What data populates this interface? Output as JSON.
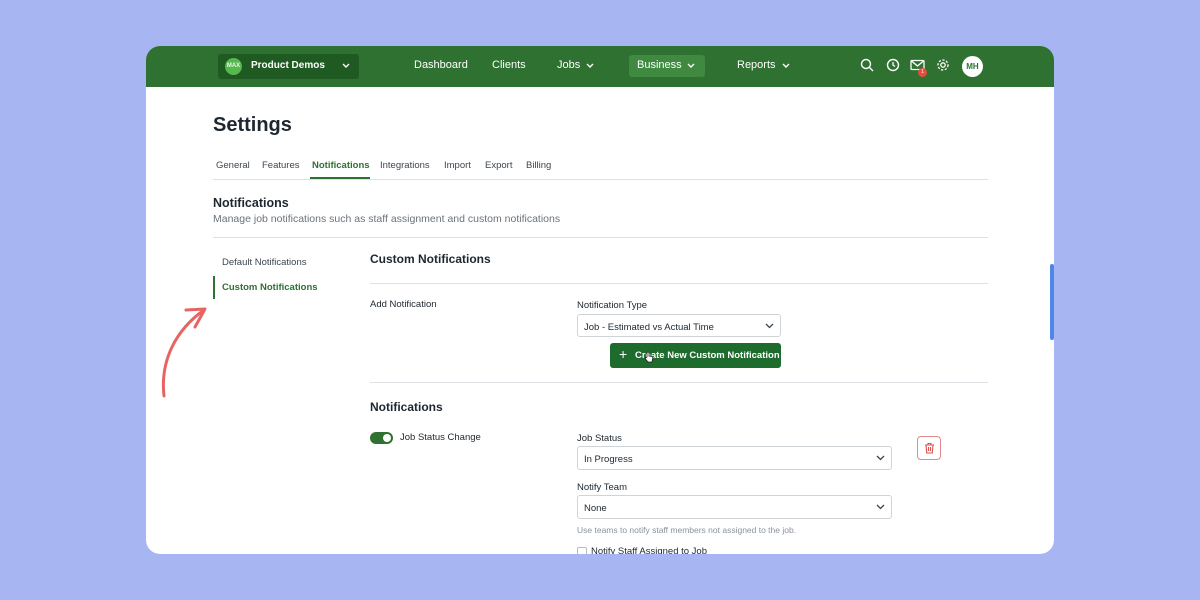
{
  "header": {
    "org_logo_text": "MAX",
    "org_name": "Product Demos",
    "nav": [
      {
        "label": "Dashboard"
      },
      {
        "label": "Clients"
      },
      {
        "label": "Jobs"
      },
      {
        "label": "Business"
      },
      {
        "label": "Reports"
      }
    ],
    "mail_badge": "1",
    "avatar_initials": "MH",
    "icons": [
      "search-icon",
      "clock-icon",
      "mail-icon",
      "gear-icon"
    ]
  },
  "page": {
    "title": "Settings",
    "tabs": [
      "General",
      "Features",
      "Notifications",
      "Integrations",
      "Import",
      "Export",
      "Billing"
    ],
    "active_tab": "Notifications"
  },
  "notifications_section": {
    "title": "Notifications",
    "description": "Manage job notifications such as staff assignment and custom notifications"
  },
  "sidebar": {
    "items": [
      {
        "label": "Default Notifications"
      },
      {
        "label": "Custom Notifications"
      }
    ],
    "active": "Custom Notifications"
  },
  "custom_notifications": {
    "title": "Custom Notifications",
    "add_label": "Add Notification",
    "type_label": "Notification Type",
    "type_value": "Job - Estimated vs Actual Time",
    "create_button": "Create New Custom Notification"
  },
  "notifications_list": {
    "title": "Notifications",
    "toggle_label": "Job Status Change",
    "toggle_on": true,
    "job_status_label": "Job Status",
    "job_status_value": "In Progress",
    "notify_team_label": "Notify Team",
    "notify_team_value": "None",
    "helper_text": "Use teams to notify staff members not assigned to the job.",
    "notify_staff_label": "Notify Staff Assigned to Job"
  },
  "colors": {
    "background": "#a8b5f3",
    "brand_green": "#2e7131",
    "button_green": "#1e6b2e",
    "danger": "#e08a8a",
    "annotation_arrow": "#e86464"
  }
}
